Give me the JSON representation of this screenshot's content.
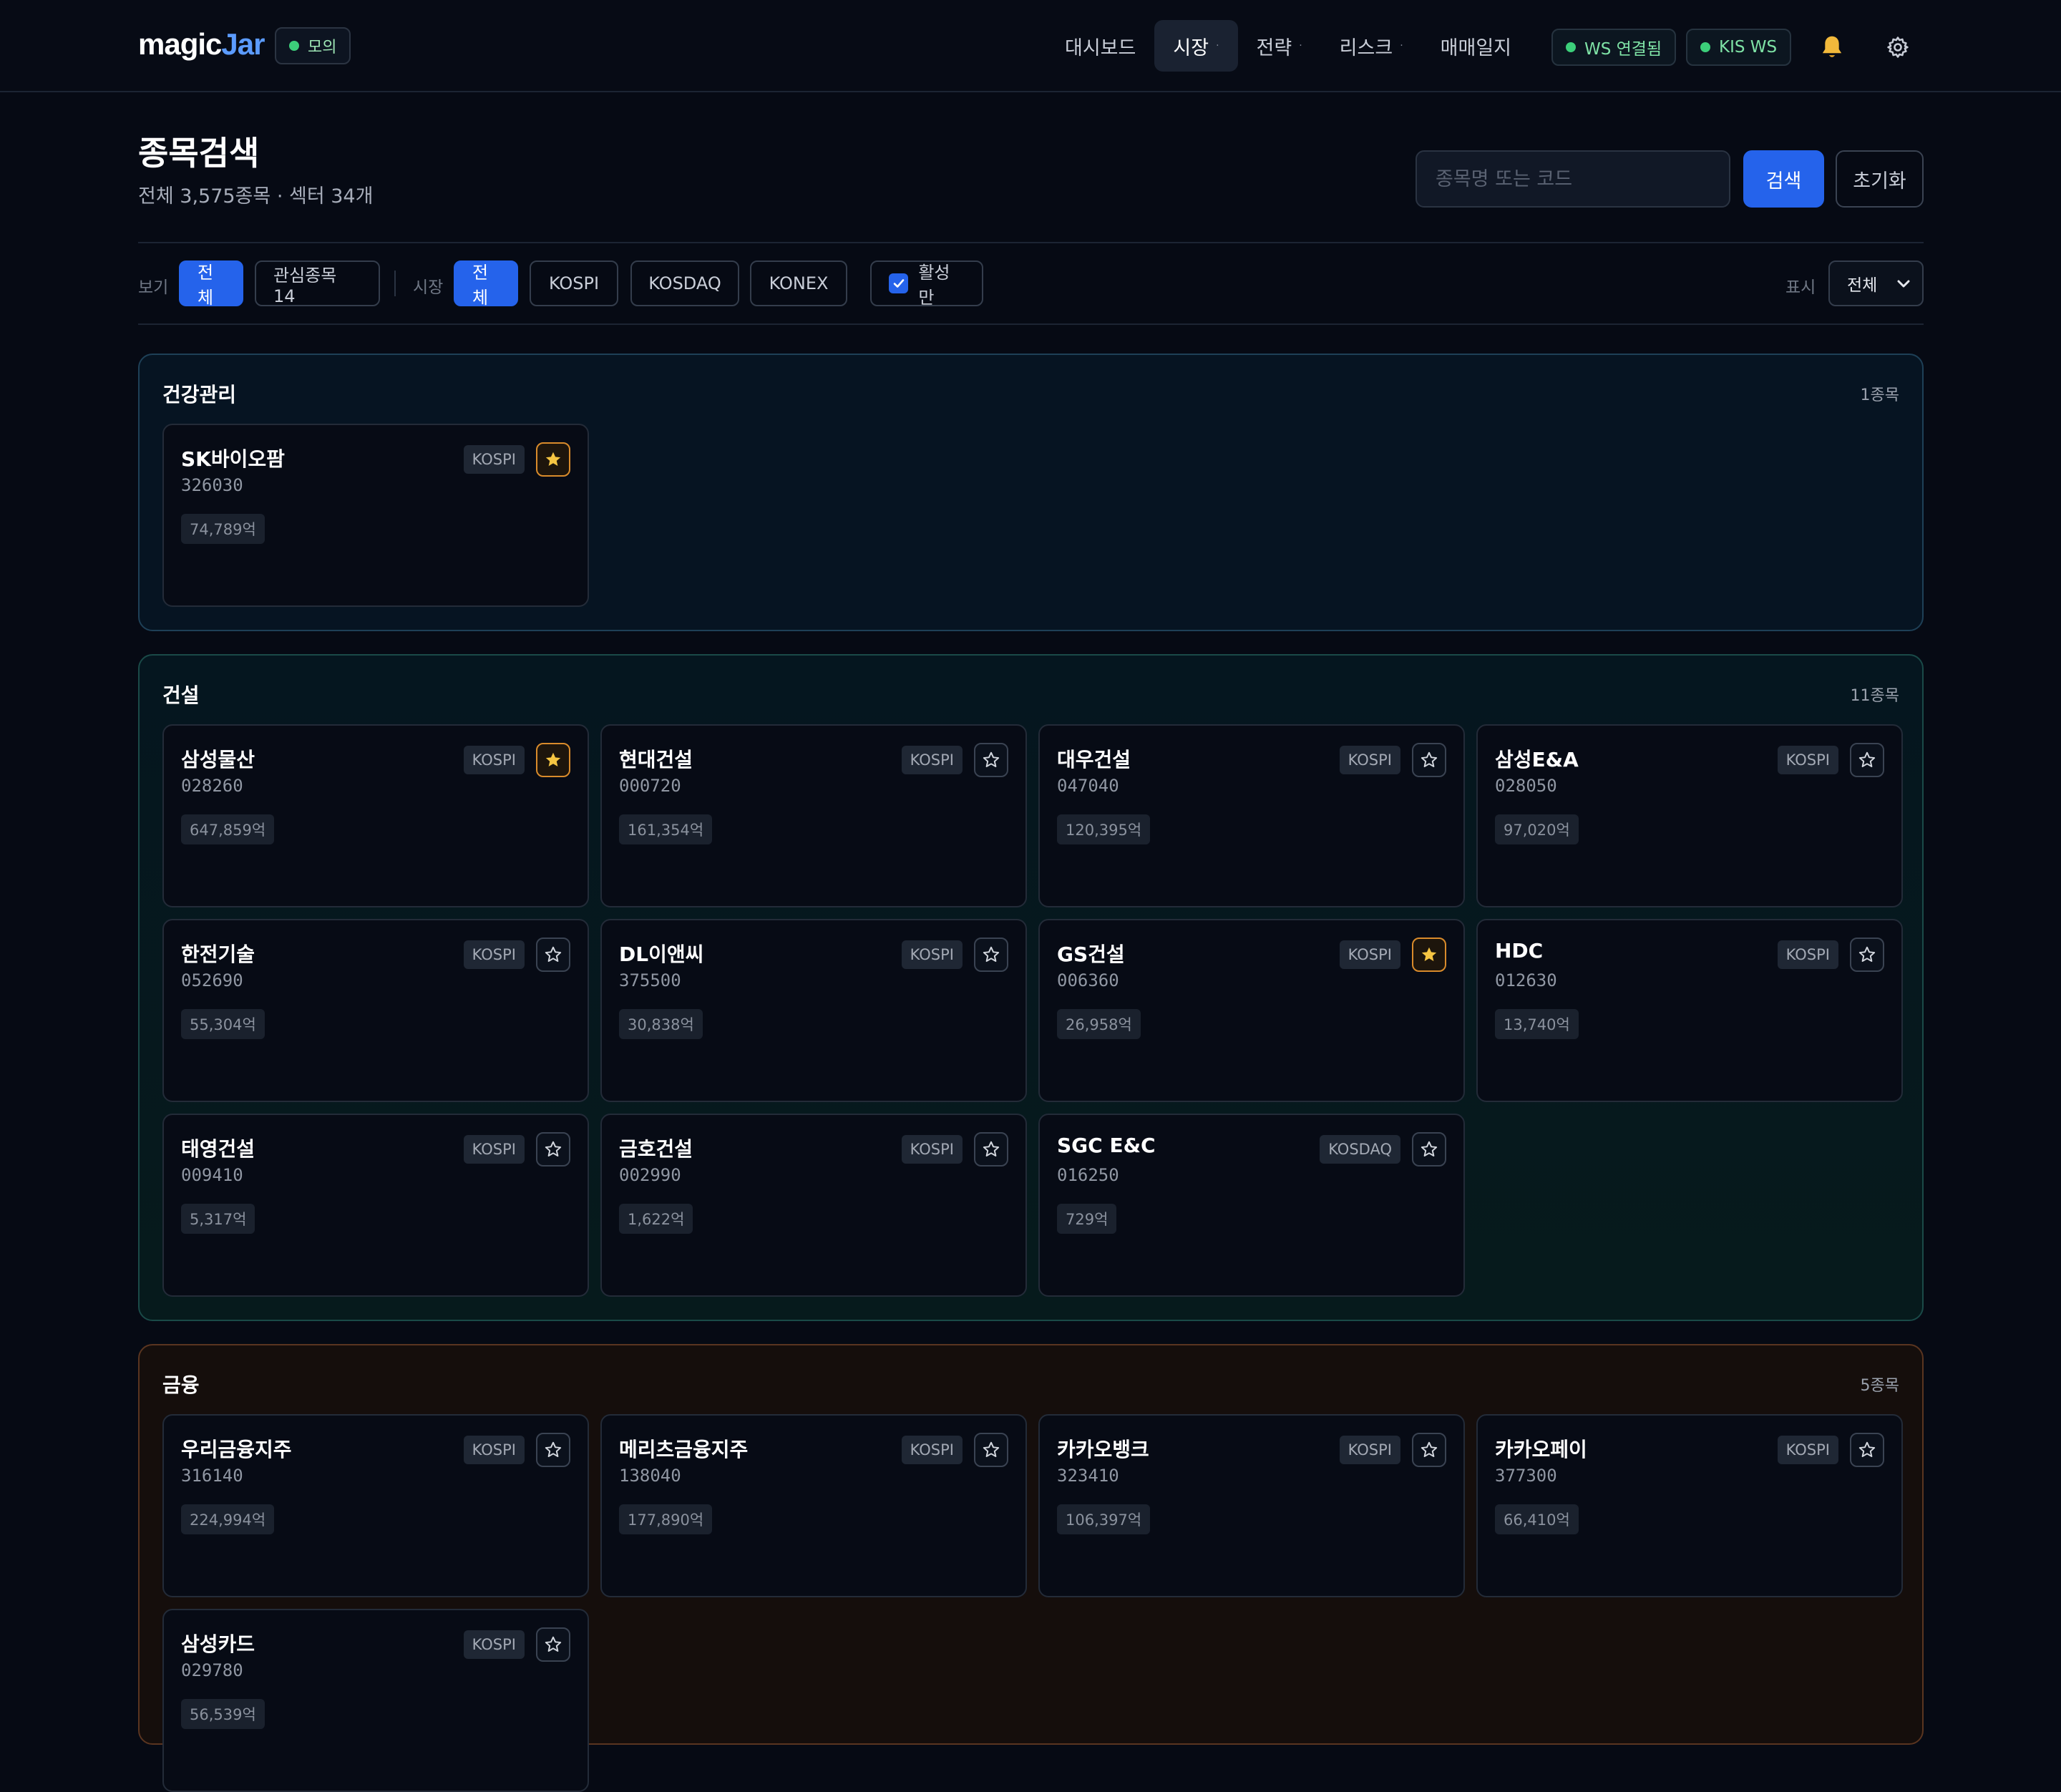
{
  "nav": {
    "brand_a": "magic",
    "brand_b": "Jar",
    "mode": "모의",
    "items": [
      {
        "label": "대시보드",
        "caret": false
      },
      {
        "label": "시장",
        "caret": true
      },
      {
        "label": "전략",
        "caret": true
      },
      {
        "label": "리스크",
        "caret": true
      },
      {
        "label": "매매일지",
        "caret": false
      }
    ],
    "ws_status": "WS 연결됨",
    "kis_status": "KIS WS",
    "caret_glyph": "·"
  },
  "header": {
    "title": "종목검색",
    "subtitle": "전체 3,575종목 · 섹터 34개",
    "search_placeholder": "종목명 또는 코드",
    "search_button": "검색",
    "reset_button": "초기화"
  },
  "filters": {
    "view_label": "보기",
    "view_all": "전체",
    "view_watchlist": "관심종목 14",
    "market_label": "시장",
    "market_all": "전체",
    "market_kospi": "KOSPI",
    "market_kosdaq": "KOSDAQ",
    "market_konex": "KONEX",
    "active_only": "활성만",
    "display_label": "표시",
    "display_value": "전체"
  },
  "sectors": [
    {
      "name": "건강관리",
      "count": "1종목",
      "stocks": [
        {
          "name": "SK바이오팜",
          "code": "326030",
          "market": "KOSPI",
          "cap": "74,789억",
          "starred": true
        }
      ]
    },
    {
      "name": "건설",
      "count": "11종목",
      "stocks": [
        {
          "name": "삼성물산",
          "code": "028260",
          "market": "KOSPI",
          "cap": "647,859억",
          "starred": true
        },
        {
          "name": "현대건설",
          "code": "000720",
          "market": "KOSPI",
          "cap": "161,354억",
          "starred": false
        },
        {
          "name": "대우건설",
          "code": "047040",
          "market": "KOSPI",
          "cap": "120,395억",
          "starred": false
        },
        {
          "name": "삼성E&A",
          "code": "028050",
          "market": "KOSPI",
          "cap": "97,020억",
          "starred": false
        },
        {
          "name": "한전기술",
          "code": "052690",
          "market": "KOSPI",
          "cap": "55,304억",
          "starred": false
        },
        {
          "name": "DL이앤씨",
          "code": "375500",
          "market": "KOSPI",
          "cap": "30,838억",
          "starred": false
        },
        {
          "name": "GS건설",
          "code": "006360",
          "market": "KOSPI",
          "cap": "26,958억",
          "starred": true
        },
        {
          "name": "HDC",
          "code": "012630",
          "market": "KOSPI",
          "cap": "13,740억",
          "starred": false
        },
        {
          "name": "태영건설",
          "code": "009410",
          "market": "KOSPI",
          "cap": "5,317억",
          "starred": false
        },
        {
          "name": "금호건설",
          "code": "002990",
          "market": "KOSPI",
          "cap": "1,622억",
          "starred": false
        },
        {
          "name": "SGC E&C",
          "code": "016250",
          "market": "KOSDAQ",
          "cap": "729억",
          "starred": false
        }
      ]
    },
    {
      "name": "금융",
      "count": "5종목",
      "stocks": [
        {
          "name": "우리금융지주",
          "code": "316140",
          "market": "KOSPI",
          "cap": "224,994억",
          "starred": false
        },
        {
          "name": "메리츠금융지주",
          "code": "138040",
          "market": "KOSPI",
          "cap": "177,890억",
          "starred": false
        },
        {
          "name": "카카오뱅크",
          "code": "323410",
          "market": "KOSPI",
          "cap": "106,397억",
          "starred": false
        },
        {
          "name": "카카오페이",
          "code": "377300",
          "market": "KOSPI",
          "cap": "66,410억",
          "starred": false
        },
        {
          "name": "삼성카드",
          "code": "029780",
          "market": "KOSPI",
          "cap": "56,539억",
          "starred": false
        }
      ]
    }
  ],
  "colors": {
    "accent": "#2563eb",
    "star_on": "#f5c542",
    "ws_dot": "#3ccf7a"
  }
}
